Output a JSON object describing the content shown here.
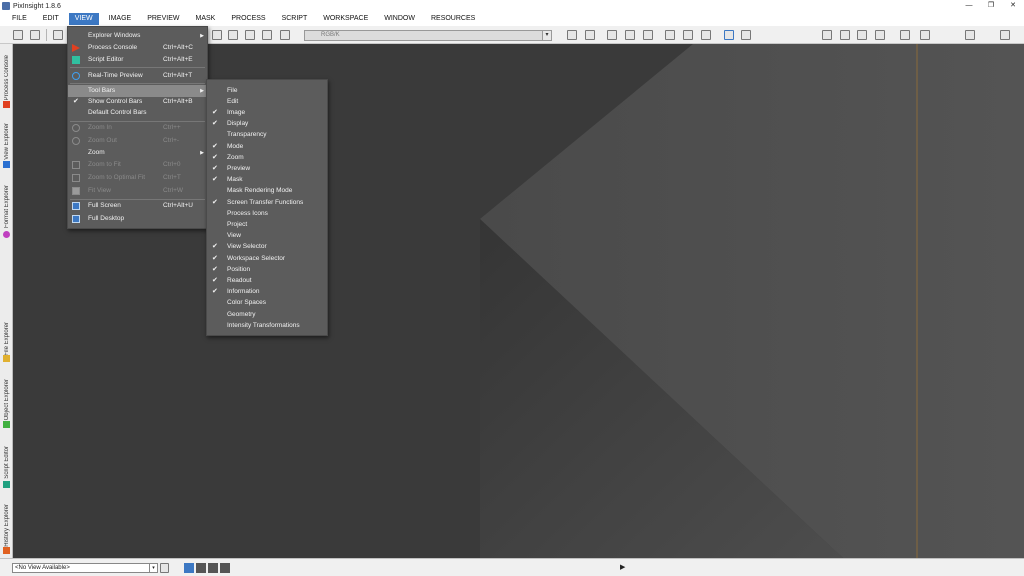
{
  "window": {
    "title": "PixInsight 1.8.6",
    "minimize": "—",
    "restore": "❐",
    "close": "✕"
  },
  "menubar": [
    "FILE",
    "EDIT",
    "VIEW",
    "IMAGE",
    "PREVIEW",
    "MASK",
    "PROCESS",
    "SCRIPT",
    "WORKSPACE",
    "WINDOW",
    "RESOURCES"
  ],
  "toolbar": {
    "color_space": "RGB/K",
    "combo_arrow": "▾"
  },
  "sidebar_tabs": [
    "Process Console",
    "View Explorer",
    "Format Explorer",
    "File Explorer",
    "Object Explorer",
    "Script Editor",
    "History Explorer"
  ],
  "view_menu": [
    {
      "label": "Explorer Windows",
      "shortcut": "",
      "submenu": "▶"
    },
    {
      "label": "Process Console",
      "shortcut": "Ctrl+Alt+C"
    },
    {
      "label": "Script Editor",
      "shortcut": "Ctrl+Alt+E"
    },
    {
      "label": "Real-Time Preview",
      "shortcut": "Ctrl+Alt+T"
    },
    {
      "label": "Tool Bars",
      "shortcut": "",
      "submenu": "▶"
    },
    {
      "label": "Show Control Bars",
      "shortcut": "Ctrl+Alt+B",
      "check": "✔"
    },
    {
      "label": "Default Control Bars",
      "shortcut": ""
    },
    {
      "label": "Zoom In",
      "shortcut": "Ctrl++"
    },
    {
      "label": "Zoom Out",
      "shortcut": "Ctrl+-"
    },
    {
      "label": "Zoom",
      "shortcut": "",
      "submenu": "▶"
    },
    {
      "label": "Zoom to Fit",
      "shortcut": "Ctrl+0"
    },
    {
      "label": "Zoom to Optimal Fit",
      "shortcut": "Ctrl+T"
    },
    {
      "label": "Fit View",
      "shortcut": "Ctrl+W"
    },
    {
      "label": "Full Screen",
      "shortcut": "Ctrl+Alt+U"
    },
    {
      "label": "Full Desktop",
      "shortcut": ""
    }
  ],
  "toolbars_submenu": [
    {
      "label": "File",
      "check": ""
    },
    {
      "label": "Edit",
      "check": ""
    },
    {
      "label": "Image",
      "check": "✔"
    },
    {
      "label": "Display",
      "check": "✔"
    },
    {
      "label": "Transparency",
      "check": ""
    },
    {
      "label": "Mode",
      "check": "✔"
    },
    {
      "label": "Zoom",
      "check": "✔"
    },
    {
      "label": "Preview",
      "check": "✔"
    },
    {
      "label": "Mask",
      "check": "✔"
    },
    {
      "label": "Mask Rendering Mode",
      "check": ""
    },
    {
      "label": "Screen Transfer Functions",
      "check": "✔"
    },
    {
      "label": "Process Icons",
      "check": ""
    },
    {
      "label": "Project",
      "check": ""
    },
    {
      "label": "View",
      "check": ""
    },
    {
      "label": "View Selector",
      "check": "✔"
    },
    {
      "label": "Workspace Selector",
      "check": "✔"
    },
    {
      "label": "Position",
      "check": "✔"
    },
    {
      "label": "Readout",
      "check": "✔"
    },
    {
      "label": "Information",
      "check": "✔"
    },
    {
      "label": "Color Spaces",
      "check": ""
    },
    {
      "label": "Geometry",
      "check": ""
    },
    {
      "label": "Intensity Transformations",
      "check": ""
    }
  ],
  "statusbar": {
    "view_selector": "<No View Available>",
    "combo_arrow": "▾",
    "play": "▶"
  },
  "colors": {
    "accent": "#3c78c3",
    "menu_bg": "#5c5c5c",
    "workspace_bg": "#3d3d3d"
  }
}
